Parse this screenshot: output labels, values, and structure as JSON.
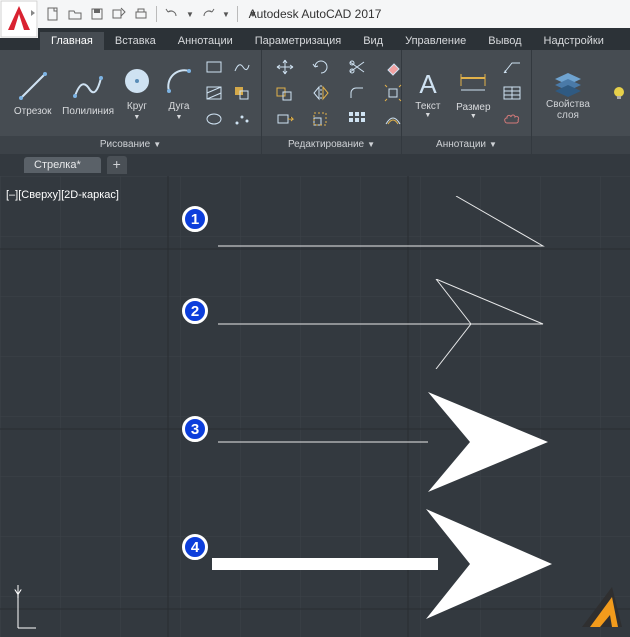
{
  "title": "Autodesk AutoCAD 2017",
  "tabs": {
    "home": "Главная",
    "insert": "Вставка",
    "annotate": "Аннотации",
    "parametric": "Параметризация",
    "view": "Вид",
    "manage": "Управление",
    "output": "Вывод",
    "addins": "Надстройки"
  },
  "panels": {
    "draw": {
      "line": "Отрезок",
      "polyline": "Полилиния",
      "circle": "Круг",
      "arc": "Дуга",
      "title": "Рисование"
    },
    "modify": {
      "title": "Редактирование"
    },
    "annotation": {
      "text": "Текст",
      "dimension": "Размер",
      "title": "Аннотации"
    },
    "layers": {
      "props": "Свойства",
      "layer": "слоя"
    }
  },
  "doc": {
    "tab": "Стрелка*"
  },
  "viewport": {
    "label": "[–][Сверху][2D-каркас]",
    "coord_y": "Y"
  },
  "callouts": {
    "c1": "1",
    "c2": "2",
    "c3": "3",
    "c4": "4"
  }
}
